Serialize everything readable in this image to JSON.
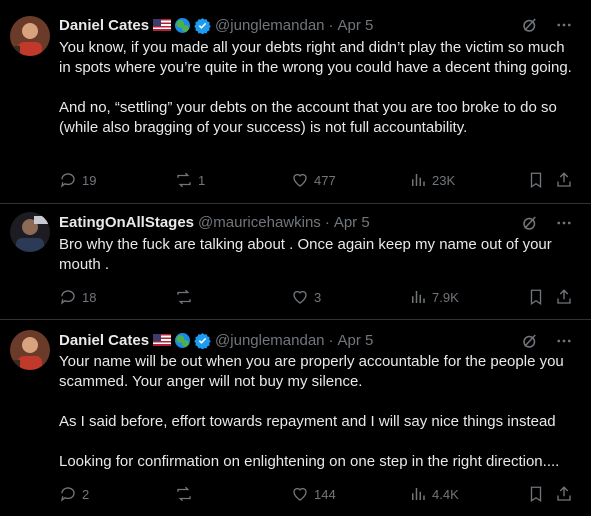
{
  "tweets": [
    {
      "name": "Daniel Cates",
      "handle": "@junglemandan",
      "dot": "·",
      "date": "Apr 5",
      "text_lines": [
        "You know, if you made all your debts right and didn’t play the victim so much in spots where you’re quite in the wrong you could have a decent thing going.",
        "And no, “settling” your debts on the account that you are too broke to do so (while also bragging of your success) is not full accountability."
      ],
      "replies": "19",
      "reposts": "1",
      "likes": "477",
      "views": "23K"
    },
    {
      "name": "EatingOnAllStages",
      "handle": "@mauricehawkins",
      "dot": "·",
      "date": "Apr 5",
      "text_lines": [
        "Bro why the fuck are talking about . Once again keep my name out of your mouth ."
      ],
      "replies": "18",
      "reposts": "",
      "likes": "3",
      "views": "7.9K"
    },
    {
      "name": "Daniel Cates",
      "handle": "@junglemandan",
      "dot": "·",
      "date": "Apr 5",
      "text_lines": [
        "Your name will be out when you are properly accountable for the people you scammed. Your anger will not buy my silence.",
        "As I said before, effort towards repayment and I will say nice things instead",
        "Looking for confirmation on enlightening on one step in the right direction...."
      ],
      "replies": "2",
      "reposts": "",
      "likes": "144",
      "views": "4.4K"
    }
  ],
  "icons": [
    "us-flag-icon",
    "globe-icon",
    "verified-badge-icon",
    "grok-icon",
    "more-icon",
    "reply-icon",
    "repost-icon",
    "like-icon",
    "views-icon",
    "bookmark-icon",
    "share-icon"
  ],
  "colors": {
    "background": "#000000",
    "text": "#e7e9ea",
    "muted": "#71767b",
    "verified": "#1d9bf0",
    "divider": "#2f3336"
  }
}
